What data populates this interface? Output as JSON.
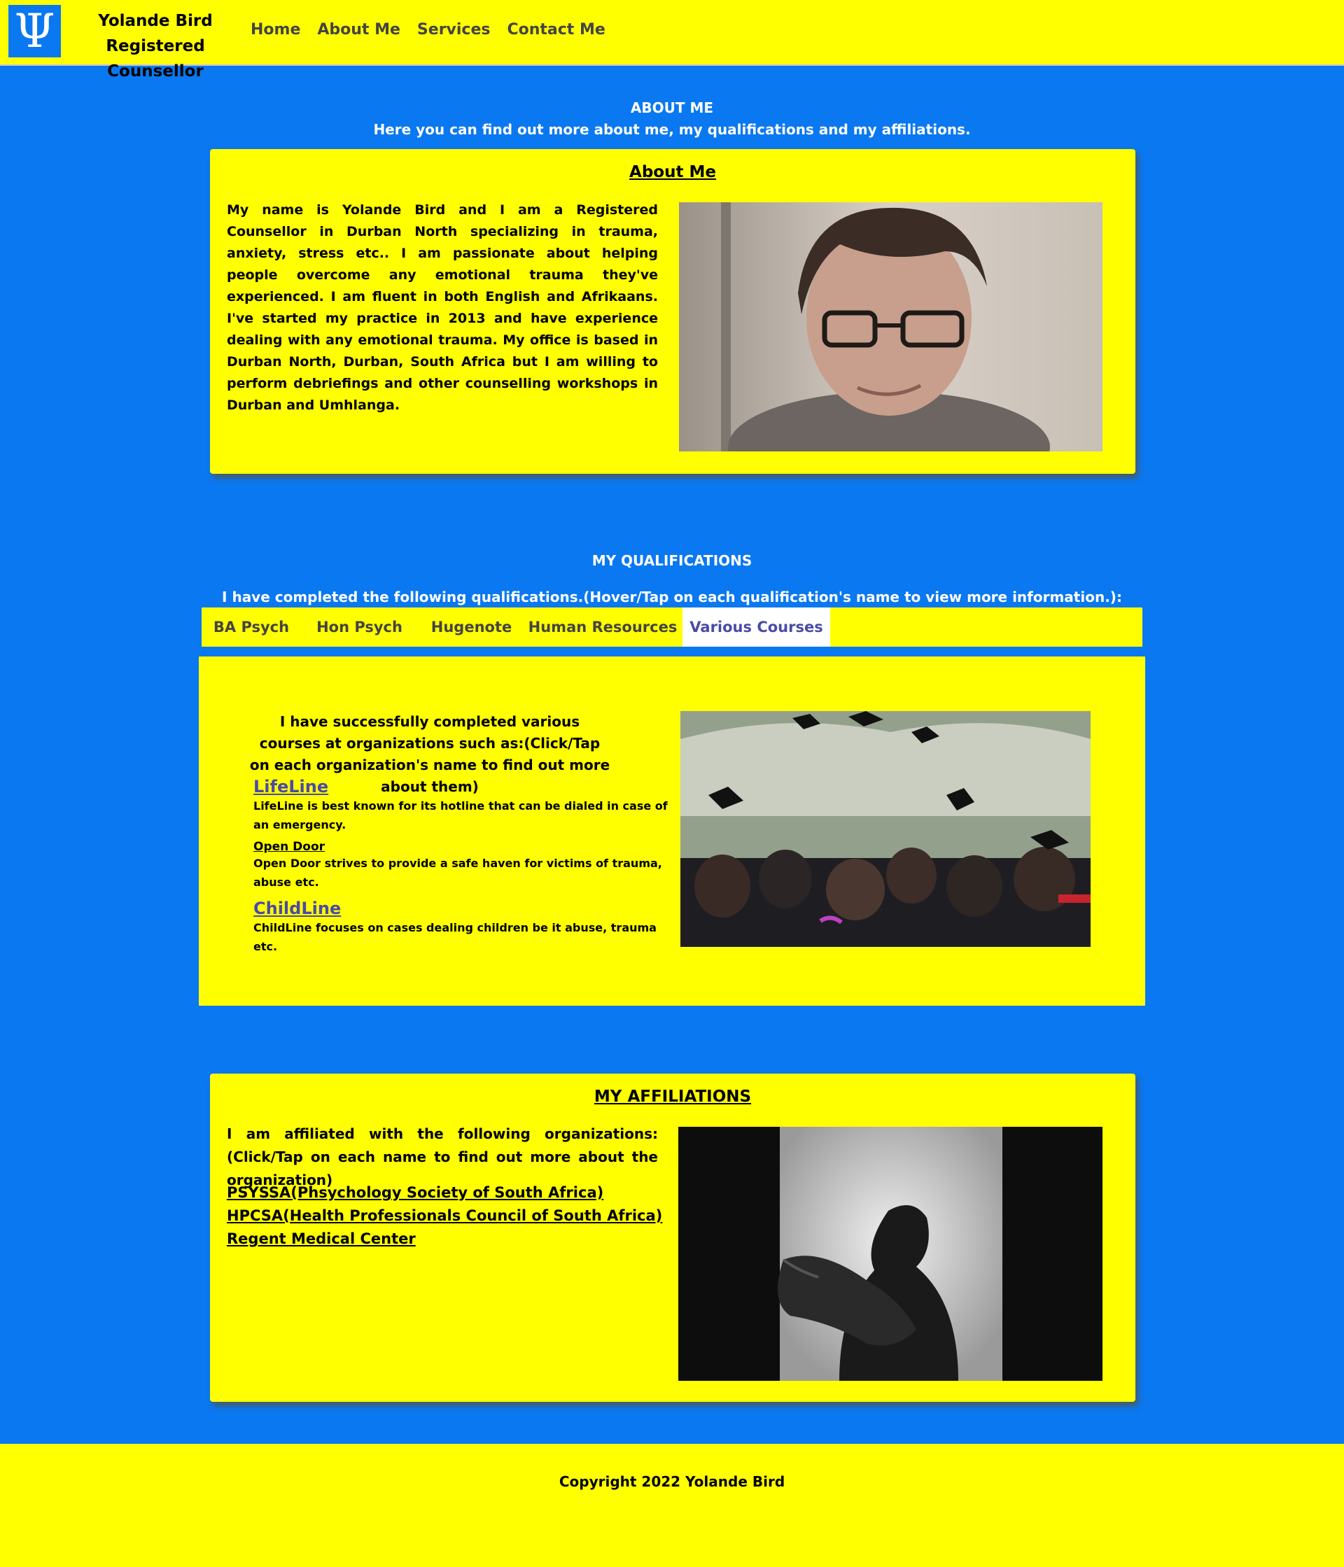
{
  "header": {
    "logo_glyph": "Ψ",
    "brand_name": "Yolande Bird",
    "brand_title": "Registered Counsellor",
    "nav": [
      "Home",
      "About Me",
      "Services",
      "Contact Me"
    ]
  },
  "intro": {
    "heading": "ABOUT ME",
    "subheading": "Here you can find out more about me, my qualifications and my affiliations."
  },
  "about": {
    "title": "About Me",
    "text": "My name is Yolande Bird and I am a Registered Counsellor in Durban North specializing in trauma, anxiety, stress etc.. I am passionate about helping people overcome any emotional trauma they've experienced. I am fluent in both English and Afrikaans. I've started my practice in 2013 and have experience dealing with any emotional trauma. My office is based in Durban North, Durban, South Africa but I am willing to perform debriefings and other counselling workshops in Durban and Umhlanga."
  },
  "qualifications": {
    "heading": "MY QUALIFICATIONS",
    "subheading": "I have completed the following qualifications.(Hover/Tap on each qualification's name to view more information.):",
    "tabs": [
      "BA Psych",
      "Hon Psych",
      "Hugenote",
      "Human Resources",
      "Various Courses"
    ],
    "active_tab": "Various Courses",
    "panel": {
      "intro": "I have successfully completed various courses at organizations such as:(Click/Tap on each organization's name to find out more about them)",
      "orgs": [
        {
          "name": "LifeLine",
          "desc": "LifeLine is best known for its hotline that can be dialed in case of an emergency."
        },
        {
          "name": "Open Door",
          "desc": "Open Door strives to provide a safe haven for victims of trauma, abuse etc."
        },
        {
          "name": "ChildLine",
          "desc": "ChildLine focuses on cases dealing children be it abuse, trauma etc."
        }
      ]
    }
  },
  "affiliations": {
    "title": "MY AFFILIATIONS",
    "text": "I am affiliated with the following organizations:(Click/Tap on each name to find out more about the organization)",
    "links": [
      "PSYSSA(Phsychology Society of South Africa)",
      "HPCSA(Health Professionals Council of South Africa)",
      "Regent Medical Center"
    ]
  },
  "footer": {
    "copyright": "Copyright 2022 Yolande Bird"
  },
  "colors": {
    "background_blue": "#0a78f0",
    "accent_yellow": "#ffff00",
    "tab_active_text": "#4a4aa8"
  }
}
